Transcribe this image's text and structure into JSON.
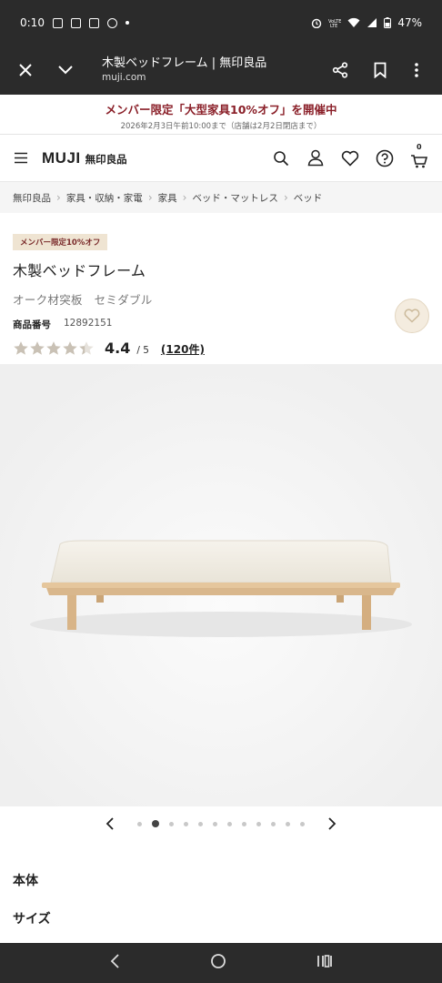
{
  "status": {
    "time": "0:10",
    "battery": "47%"
  },
  "browser": {
    "title": "木製ベッドフレーム | 無印良品",
    "url": "muji.com"
  },
  "promo": {
    "headline": "メンバー限定「大型家具10%オフ」を開催中",
    "subline": "2026年2月3日午前10:00まで（店舗は2月2日閉店まで）"
  },
  "header": {
    "logo": "MUJI",
    "logo_jp": "無印良品",
    "cart_count": "0"
  },
  "breadcrumbs": [
    "無印良品",
    "家具・収納・家電",
    "家具",
    "ベッド・マットレス",
    "ベッド"
  ],
  "product": {
    "badge": "メンバー限定10%オフ",
    "title": "木製ベッドフレーム",
    "variant": "オーク材突板　セミダブル",
    "code_label": "商品番号",
    "code": "12892151",
    "rating": "4.4",
    "rating_max": "/ 5",
    "review_count": "(120件)",
    "rating_value": 4.4
  },
  "carousel": {
    "total": 12,
    "active_index": 1
  },
  "sections": [
    "本体",
    "サイズ"
  ],
  "colors": {
    "promo_text": "#8a1f28",
    "star": "#c9c1b5",
    "fav_bg": "#f4ecdf",
    "chrome": "#2b2b2b"
  }
}
